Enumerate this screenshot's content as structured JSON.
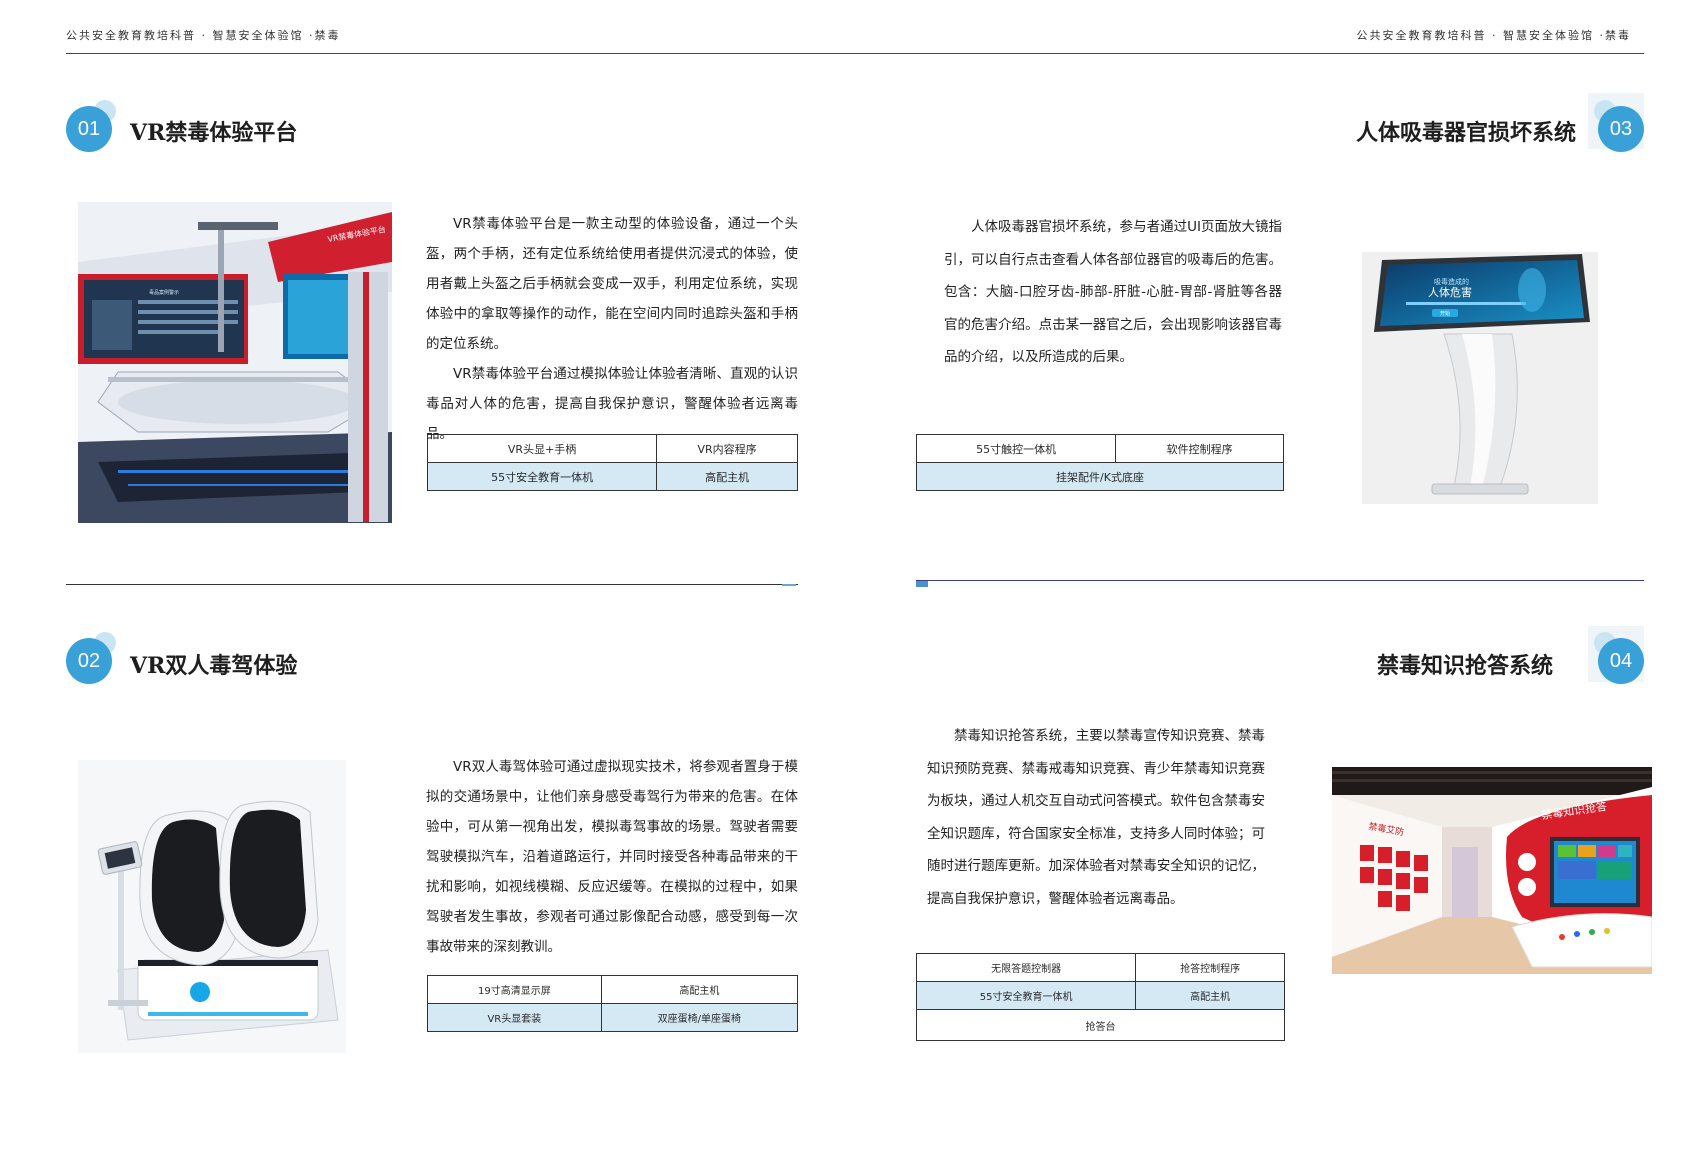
{
  "header": {
    "left": "公共安全教育教培科普 · 智慧安全体验馆 ·禁毒",
    "right": "公共安全教育教培科普 · 智慧安全体验馆 ·禁毒"
  },
  "sections": [
    {
      "num": "01",
      "title": "VR禁毒体验平台",
      "paragraphs": [
        "VR禁毒体验平台是一款主动型的体验设备，通过一个头盔，两个手柄，还有定位系统给使用者提供沉浸式的体验，使用者戴上头盔之后手柄就会变成一双手，利用定位系统，实现体验中的拿取等操作的动作，能在空间内同时追踪头盔和手柄的定位系统。",
        "VR禁毒体验平台通过模拟体验让体验者清晰、直观的认识毒品对人体的危害，提高自我保护意识，警醒体验者远离毒品。"
      ],
      "table": [
        [
          "VR头显+手柄",
          "VR内容程序"
        ],
        [
          "55寸安全教育一体机",
          "高配主机"
        ]
      ],
      "image_text": [
        "VR禁毒体验平台",
        "毒品案例警示"
      ]
    },
    {
      "num": "02",
      "title": "VR双人毒驾体验",
      "paragraphs": [
        "VR双人毒驾体验可通过虚拟现实技术，将参观者置身于模拟的交通场景中，让他们亲身感受毒驾行为带来的危害。在体验中，可从第一视角出发，模拟毒驾事故的场景。驾驶者需要驾驶模拟汽车，沿着道路运行，并同时接受各种毒品带来的干扰和影响，如视线模糊、反应迟缓等。在模拟的过程中，如果驾驶者发生事故，参观者可通过影像配合动感，感受到每一次事故带来的深刻教训。"
      ],
      "table": [
        [
          "19寸高清显示屏",
          "高配主机"
        ],
        [
          "VR头显套装",
          "双座蛋椅/单座蛋椅"
        ]
      ]
    },
    {
      "num": "03",
      "title": "人体吸毒器官损坏系统",
      "paragraphs": [
        "人体吸毒器官损坏系统，参与者通过UI页面放大镜指引，可以自行点击查看人体各部位器官的吸毒后的危害。包含：大脑-口腔牙齿-肺部-肝脏-心脏-胃部-肾脏等各器官的危害介绍。点击某一器官之后，会出现影响该器官毒品的介绍，以及所造成的后果。"
      ],
      "table": [
        [
          "55寸触控一体机",
          "软件控制程序"
        ],
        [
          "挂架配件/K式底座"
        ]
      ],
      "image_text": [
        "吸毒造成的",
        "人体危害",
        "开始"
      ]
    },
    {
      "num": "04",
      "title": "禁毒知识抢答系统",
      "paragraphs": [
        "禁毒知识抢答系统，主要以禁毒宣传知识竞赛、禁毒知识预防竞赛、禁毒戒毒知识竞赛、青少年禁毒知识竞赛为板块，通过人机交互自动式问答模式。软件包含禁毒安全知识题库，符合国家安全标准，支持多人同时体验；可随时进行题库更新。加深体验者对禁毒安全知识的记忆，提高自我保护意识，警醒体验者远离毒品。"
      ],
      "table": [
        [
          "无限答题控制器",
          "抢答控制程序"
        ],
        [
          "55寸安全教育一体机",
          "高配主机"
        ],
        [
          "抢答台"
        ]
      ],
      "image_text": [
        "禁毒知识抢答",
        "禁毒艾防"
      ]
    }
  ]
}
